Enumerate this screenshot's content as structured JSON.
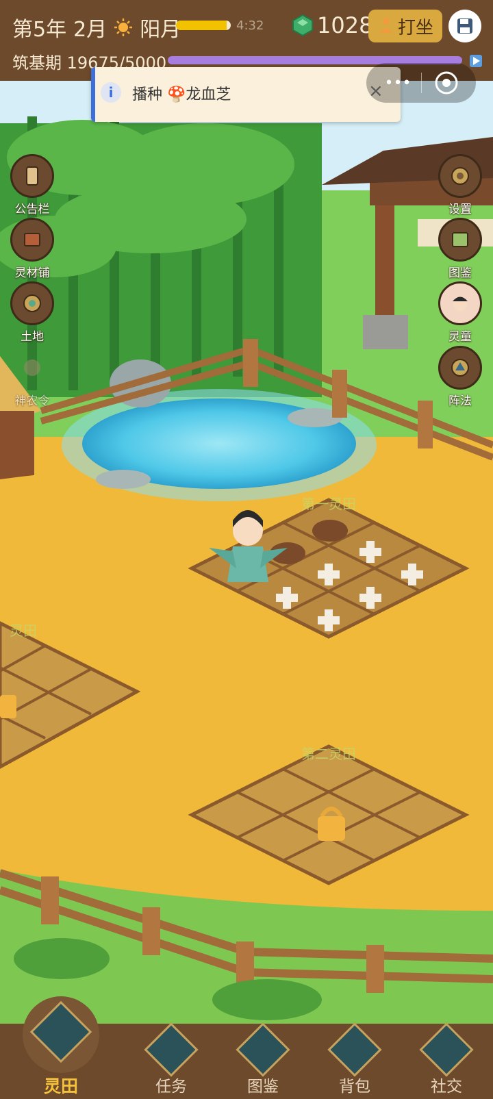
{
  "header": {
    "year": "第5年",
    "month": "2月",
    "weather_icon": "sun-icon",
    "weather": "阳月",
    "time_progress": 0.92,
    "time": "4:32",
    "spirit_stones": "1028",
    "meditate_label": "打坐",
    "realm": "筑基期",
    "exp_text": "19675/5000",
    "exp_progress": 1.0
  },
  "toast": {
    "text": "播种 🍄龙血芝",
    "close": "×",
    "info": "i"
  },
  "capsule": {
    "menu": "•••"
  },
  "left_buttons": [
    {
      "label": "公告栏",
      "icon": "scroll-icon"
    },
    {
      "label": "灵材铺",
      "icon": "shop-icon"
    },
    {
      "label": "土地",
      "icon": "land-icon"
    },
    {
      "label": "神农令",
      "icon": "token-icon"
    }
  ],
  "right_buttons": [
    {
      "label": "设置",
      "icon": "gear-icon"
    },
    {
      "label": "图鉴",
      "icon": "book-icon"
    },
    {
      "label": "灵童",
      "icon": "spirit-child-icon"
    },
    {
      "label": "阵法",
      "icon": "formation-icon"
    }
  ],
  "fields": [
    {
      "label": "第一灵田"
    },
    {
      "label": "灵田"
    },
    {
      "label": "第二灵田"
    }
  ],
  "bottom_nav": [
    {
      "label": "灵田",
      "icon": "lotus-icon",
      "active": true
    },
    {
      "label": "任务",
      "icon": "task-scroll-icon",
      "active": false
    },
    {
      "label": "图鉴",
      "icon": "encyclopedia-icon",
      "active": false
    },
    {
      "label": "背包",
      "icon": "bag-icon",
      "active": false
    },
    {
      "label": "社交",
      "icon": "social-icon",
      "active": false
    }
  ],
  "colors": {
    "bar_bg": "#6e4a2c",
    "sand": "#f0b93a",
    "grass": "#6fb83d",
    "exp": "#a77ee0",
    "time": "#f2c200"
  }
}
